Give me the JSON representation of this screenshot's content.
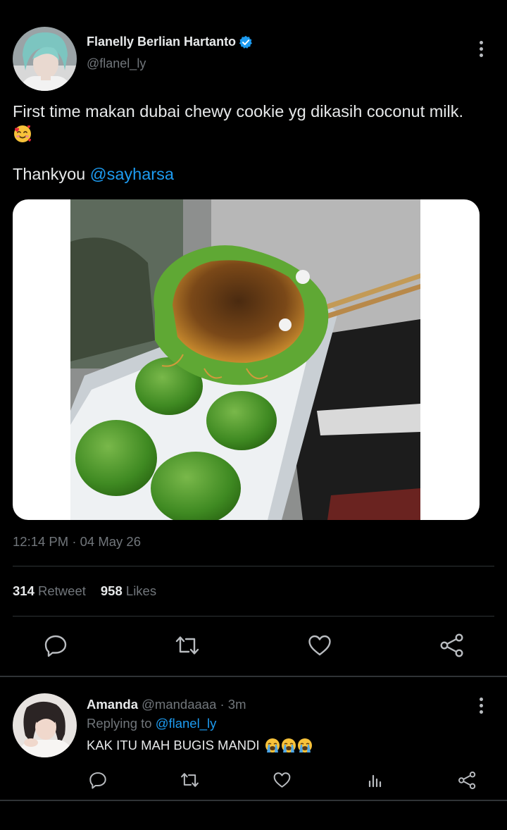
{
  "tweet": {
    "author_name": "Flanelly Berlian Hartanto",
    "author_handle": "@flanel_ly",
    "text_line1": "First time makan dubai chewy cookie yg dikasih coconut milk.",
    "text_emoji": "smiling-face-with-hearts",
    "thanks_text": "Thankyou",
    "mention": "@sayharsa",
    "timestamp": "12:14 PM · 04 May 26",
    "retweet_count": "314",
    "retweet_label": "Retweet",
    "likes_count": "958",
    "likes_label": "Likes",
    "actions": [
      "reply-icon",
      "retweet-icon",
      "like-icon",
      "share-icon"
    ]
  },
  "reply": {
    "author_name": "Amanda",
    "author_handle": "@mandaaaa",
    "time": "· 3m",
    "replying_prefix": "Replying to",
    "replying_to": "@flanel_ly",
    "text": "KAK ITU MAH BUGIS MANDI",
    "text_emojis": [
      "loudly-crying-face",
      "loudly-crying-face",
      "loudly-crying-face"
    ],
    "actions": [
      "reply-icon",
      "retweet-icon",
      "like-icon",
      "analytics-icon",
      "share-icon"
    ]
  },
  "colors": {
    "background": "#000000",
    "text": "#e7e9ea",
    "muted": "#71767b",
    "link": "#1d9bf0",
    "verified": "#1d9bf0",
    "divider": "#2f3336"
  }
}
